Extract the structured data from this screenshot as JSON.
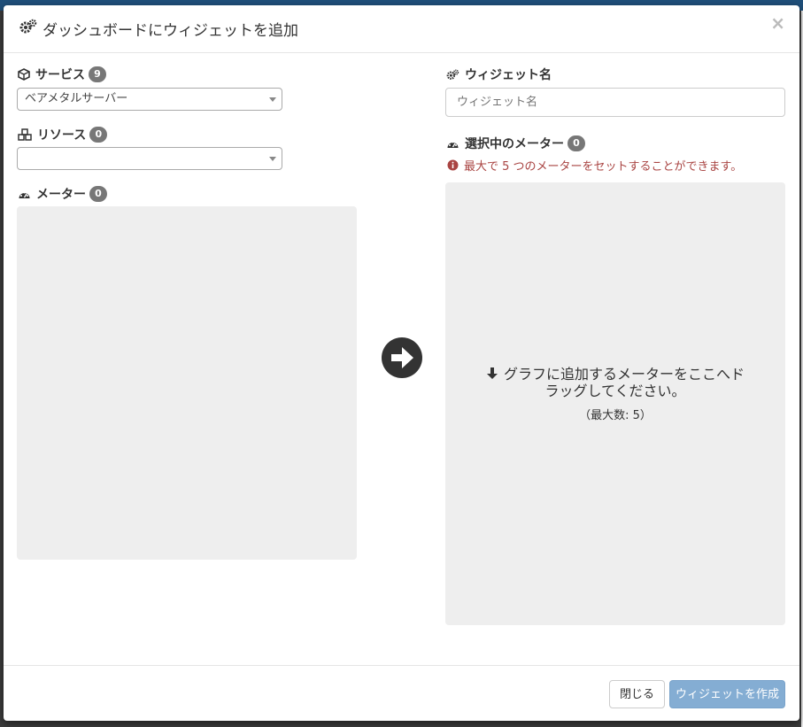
{
  "modal": {
    "title": "ダッシュボードにウィジェットを追加",
    "close_label": "×"
  },
  "left": {
    "service": {
      "label": "サービス",
      "count": "9",
      "selected": "ベアメタルサーバー"
    },
    "resource": {
      "label": "リソース",
      "count": "0",
      "selected": ""
    },
    "meters": {
      "label": "メーター",
      "count": "0"
    }
  },
  "right": {
    "widget_name": {
      "label": "ウィジェット名",
      "placeholder": "ウィジェット名"
    },
    "selected_meters": {
      "label": "選択中のメーター",
      "count": "0",
      "warning": "最大で 5 つのメーターをセットすることができます。"
    },
    "drop_zone": {
      "message_line1": "グラフに追加するメーターをここへド",
      "message_line2": "ラッグしてください。",
      "max_note": "（最大数: 5）"
    }
  },
  "footer": {
    "close_button": "閉じる",
    "create_button": "ウィジェットを作成"
  },
  "colors": {
    "primary_button": "#84add3",
    "warning_text": "#a94442",
    "badge": "#777777",
    "panel_bg": "#eeeeee"
  }
}
